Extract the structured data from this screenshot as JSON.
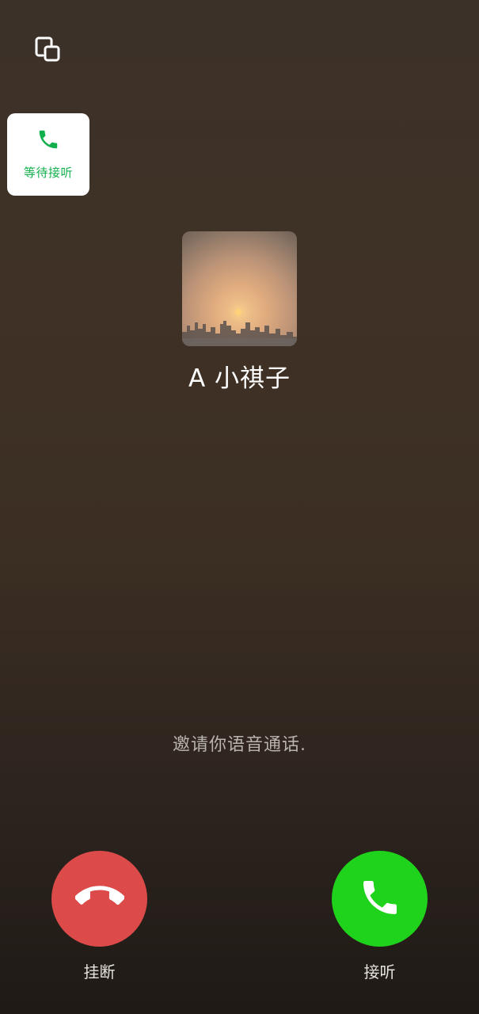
{
  "top": {
    "minimize_icon": "floating-window-icon"
  },
  "floating_card": {
    "icon": "phone-icon",
    "label": "等待接听",
    "accent_color": "#12b04c"
  },
  "caller": {
    "name": "A 小祺子",
    "avatar": "sunset-city-photo"
  },
  "status": {
    "text": "邀请你语音通话."
  },
  "actions": {
    "decline": {
      "label": "挂断",
      "icon": "hang-up-icon",
      "color": "#dc4b4a"
    },
    "accept": {
      "label": "接听",
      "icon": "phone-icon",
      "color": "#1fd21b"
    }
  }
}
